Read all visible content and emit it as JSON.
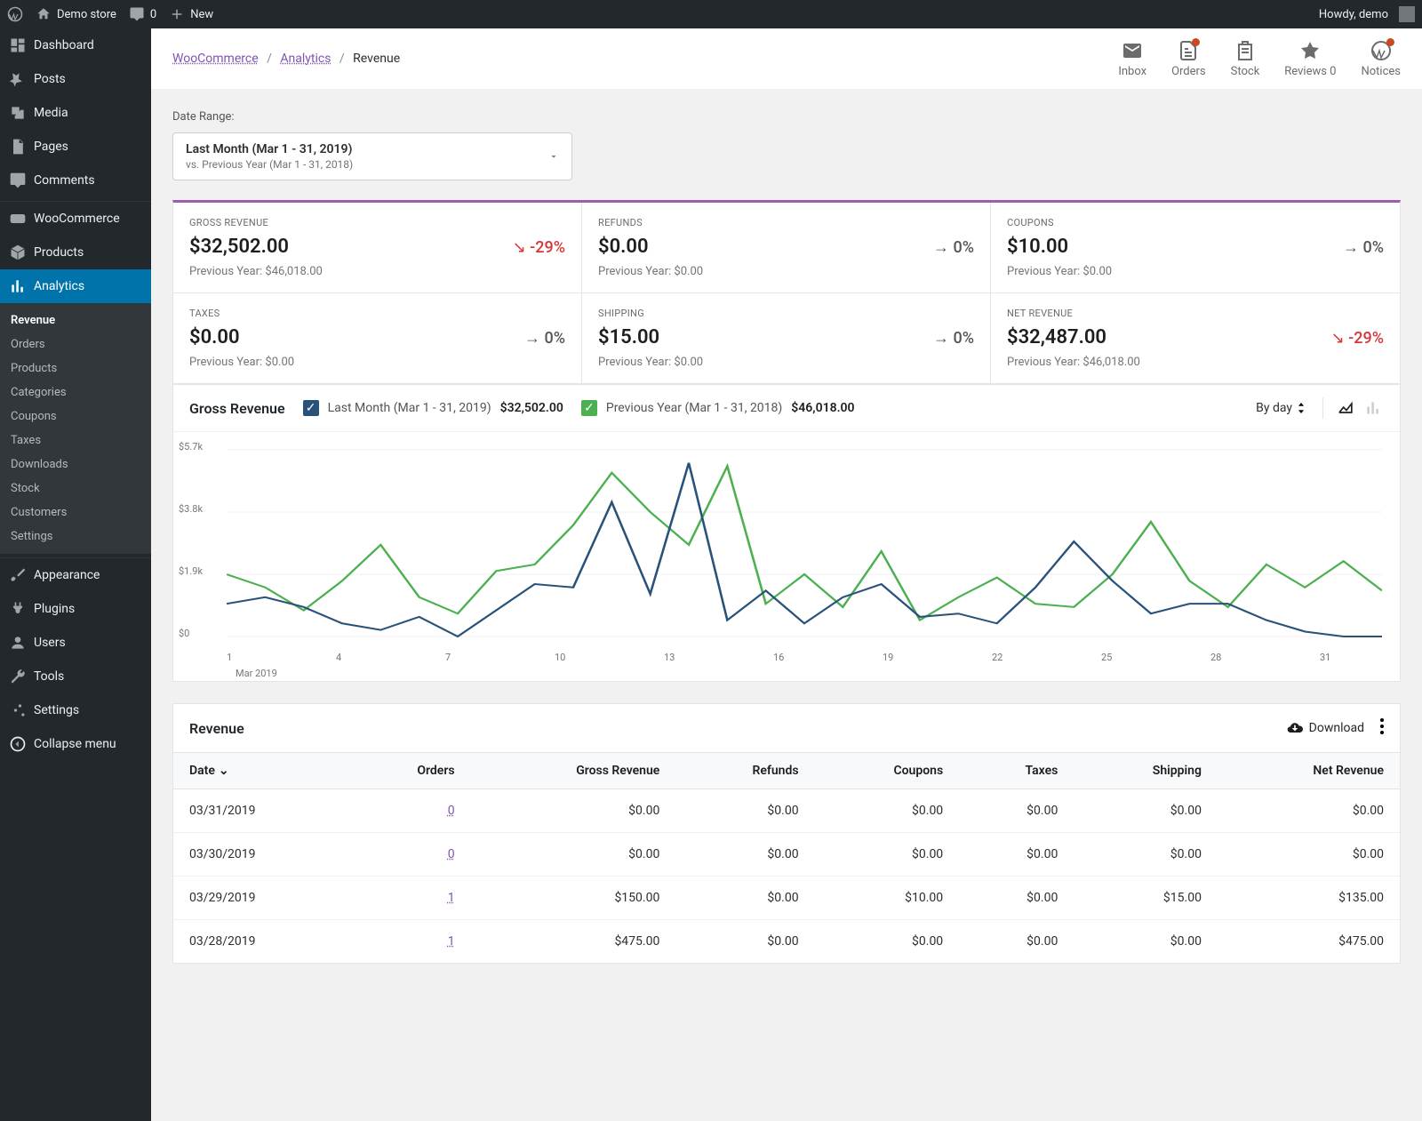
{
  "toolbar": {
    "site_name": "Demo store",
    "comments_count": "0",
    "new_label": "New",
    "howdy": "Howdy, demo"
  },
  "sidebar": {
    "items": [
      {
        "label": "Dashboard",
        "icon": "dash"
      },
      {
        "label": "Posts",
        "icon": "pin"
      },
      {
        "label": "Media",
        "icon": "media"
      },
      {
        "label": "Pages",
        "icon": "page"
      },
      {
        "label": "Comments",
        "icon": "comment"
      },
      {
        "label": "WooCommerce",
        "icon": "woo"
      },
      {
        "label": "Products",
        "icon": "box"
      },
      {
        "label": "Analytics",
        "icon": "chart"
      },
      {
        "label": "Appearance",
        "icon": "brush"
      },
      {
        "label": "Plugins",
        "icon": "plug"
      },
      {
        "label": "Users",
        "icon": "user"
      },
      {
        "label": "Tools",
        "icon": "wrench"
      },
      {
        "label": "Settings",
        "icon": "sliders"
      },
      {
        "label": "Collapse menu",
        "icon": "collapse"
      }
    ],
    "analytics_submenu": [
      "Revenue",
      "Orders",
      "Products",
      "Categories",
      "Coupons",
      "Taxes",
      "Downloads",
      "Stock",
      "Customers",
      "Settings"
    ]
  },
  "header": {
    "breadcrumb": {
      "woocommerce": "WooCommerce",
      "analytics": "Analytics",
      "current": "Revenue"
    },
    "icons": [
      {
        "label": "Inbox",
        "name": "inbox",
        "dot": false
      },
      {
        "label": "Orders",
        "name": "orders",
        "dot": true
      },
      {
        "label": "Stock",
        "name": "stock",
        "dot": false
      },
      {
        "label": "Reviews 0",
        "name": "reviews",
        "dot": false
      },
      {
        "label": "Notices",
        "name": "notices",
        "dot": true
      }
    ]
  },
  "date_range": {
    "label": "Date Range:",
    "main": "Last Month (Mar 1 - 31, 2019)",
    "sub": "vs. Previous Year (Mar 1 - 31, 2018)"
  },
  "summary": [
    {
      "title": "GROSS REVENUE",
      "value": "$32,502.00",
      "delta": "-29%",
      "trend": "down",
      "prev": "Previous Year: $46,018.00"
    },
    {
      "title": "REFUNDS",
      "value": "$0.00",
      "delta": "0%",
      "trend": "flat",
      "prev": "Previous Year: $0.00"
    },
    {
      "title": "COUPONS",
      "value": "$10.00",
      "delta": "0%",
      "trend": "flat",
      "prev": "Previous Year: $0.00"
    },
    {
      "title": "TAXES",
      "value": "$0.00",
      "delta": "0%",
      "trend": "flat",
      "prev": "Previous Year: $0.00"
    },
    {
      "title": "SHIPPING",
      "value": "$15.00",
      "delta": "0%",
      "trend": "flat",
      "prev": "Previous Year: $0.00"
    },
    {
      "title": "NET REVENUE",
      "value": "$32,487.00",
      "delta": "-29%",
      "trend": "down",
      "prev": "Previous Year: $46,018.00"
    }
  ],
  "chart": {
    "title": "Gross Revenue",
    "series_a": {
      "label": "Last Month (Mar 1 - 31, 2019)",
      "value": "$32,502.00"
    },
    "series_b": {
      "label": "Previous Year (Mar 1 - 31, 2018)",
      "value": "$46,018.00"
    },
    "by": "By day",
    "yticks": [
      "$5.7k",
      "$3.8k",
      "$1.9k",
      "$0"
    ],
    "xticks": [
      "1",
      "4",
      "7",
      "10",
      "13",
      "16",
      "19",
      "22",
      "25",
      "28",
      "31"
    ],
    "month": "Mar 2019"
  },
  "chart_data": {
    "type": "line",
    "title": "Gross Revenue",
    "xlabel": "Mar 2019",
    "ylabel": "",
    "ylim": [
      0,
      5700
    ],
    "x": [
      1,
      2,
      3,
      4,
      5,
      6,
      7,
      8,
      9,
      10,
      11,
      12,
      13,
      14,
      15,
      16,
      17,
      18,
      19,
      20,
      21,
      22,
      23,
      24,
      25,
      26,
      27,
      28,
      29,
      30,
      31
    ],
    "series": [
      {
        "name": "Last Month (Mar 1 - 31, 2019)",
        "values": [
          1000,
          1200,
          900,
          400,
          200,
          600,
          0,
          800,
          1600,
          1500,
          4100,
          1300,
          5300,
          500,
          1400,
          400,
          1200,
          1600,
          600,
          700,
          400,
          1500,
          2900,
          1700,
          700,
          1000,
          1000,
          500,
          150,
          0,
          0
        ]
      },
      {
        "name": "Previous Year (Mar 1 - 31, 2018)",
        "values": [
          1900,
          1500,
          800,
          1700,
          2800,
          1200,
          700,
          2000,
          2200,
          3400,
          5000,
          3800,
          2800,
          5200,
          1000,
          1900,
          900,
          2600,
          500,
          1200,
          1800,
          1000,
          900,
          1900,
          3500,
          1700,
          900,
          2200,
          1500,
          2300,
          1400
        ]
      }
    ]
  },
  "table": {
    "title": "Revenue",
    "download": "Download",
    "columns": [
      "Date",
      "Orders",
      "Gross Revenue",
      "Refunds",
      "Coupons",
      "Taxes",
      "Shipping",
      "Net Revenue"
    ],
    "rows": [
      {
        "date": "03/31/2019",
        "orders": "0",
        "gross": "$0.00",
        "refunds": "$0.00",
        "coupons": "$0.00",
        "taxes": "$0.00",
        "shipping": "$0.00",
        "net": "$0.00"
      },
      {
        "date": "03/30/2019",
        "orders": "0",
        "gross": "$0.00",
        "refunds": "$0.00",
        "coupons": "$0.00",
        "taxes": "$0.00",
        "shipping": "$0.00",
        "net": "$0.00"
      },
      {
        "date": "03/29/2019",
        "orders": "1",
        "gross": "$150.00",
        "refunds": "$0.00",
        "coupons": "$10.00",
        "taxes": "$0.00",
        "shipping": "$15.00",
        "net": "$135.00"
      },
      {
        "date": "03/28/2019",
        "orders": "1",
        "gross": "$475.00",
        "refunds": "$0.00",
        "coupons": "$0.00",
        "taxes": "$0.00",
        "shipping": "$0.00",
        "net": "$475.00"
      }
    ]
  }
}
